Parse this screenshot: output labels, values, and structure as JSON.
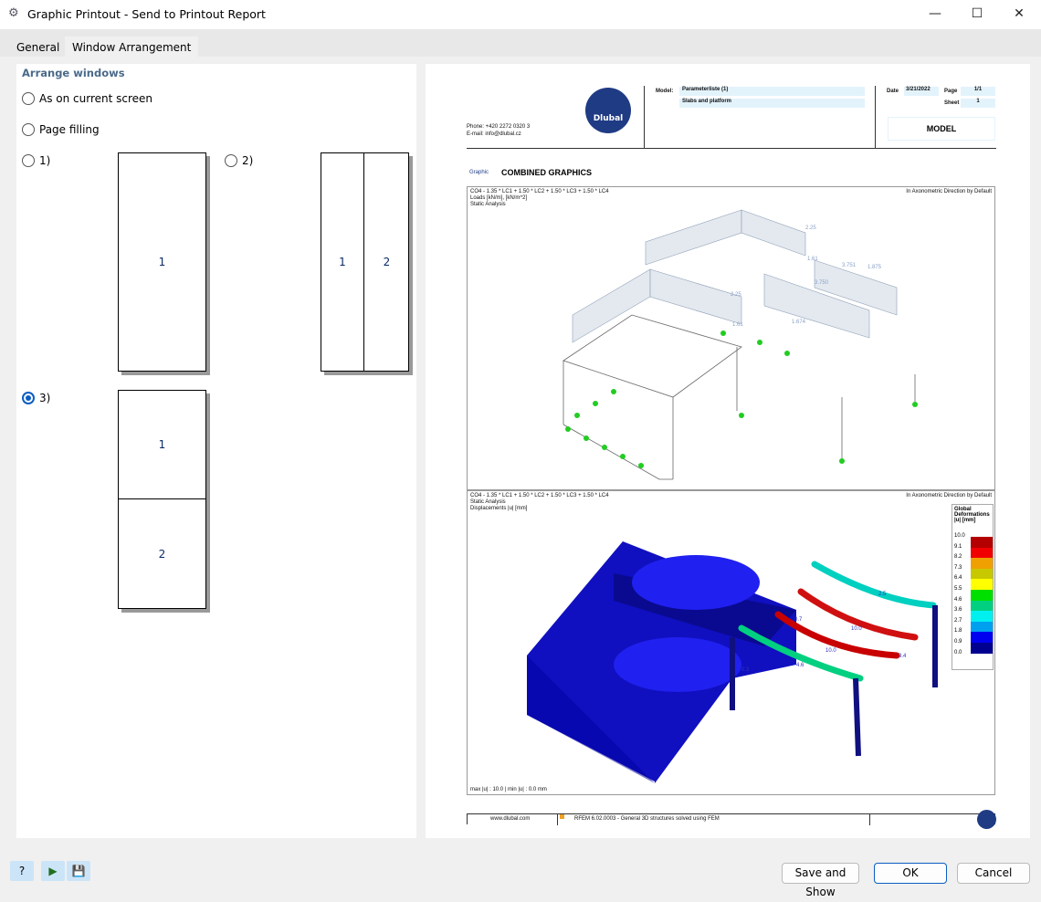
{
  "window": {
    "title": "Graphic Printout - Send to Printout Report",
    "minimize": "—",
    "maximize": "☐",
    "close": "✕",
    "app_icon": "printout-icon"
  },
  "tabs": [
    {
      "label": "General",
      "active": false
    },
    {
      "label": "Window Arrangement",
      "active": true
    }
  ],
  "arrange": {
    "heading": "Arrange windows",
    "options": [
      {
        "label": "As on current screen",
        "selected": false
      },
      {
        "label": "Page filling",
        "selected": false
      },
      {
        "label": "1)",
        "selected": false,
        "cells": [
          "1"
        ]
      },
      {
        "label": "2)",
        "selected": false,
        "cells": [
          "1",
          "2"
        ]
      },
      {
        "label": "3)",
        "selected": true,
        "cells": [
          "1",
          "2"
        ]
      }
    ]
  },
  "preview": {
    "header": {
      "phone": "Phone: +420 2272 0320 3",
      "email": "E-mail: info@dlubal.cz",
      "logo_text": "Dlubal",
      "model_label": "Model:",
      "model_name": "Parameterliste (1)",
      "model_desc": "Slabs and platform",
      "date_label": "Date",
      "date": "3/21/2022",
      "page_label": "Page",
      "page": "1/1",
      "sheet_label": "Sheet",
      "sheet": "1",
      "section": "MODEL"
    },
    "graphic_label": "Graphic",
    "graphic_title": "COMBINED GRAPHICS",
    "graphic1": {
      "combo": "CO4 - 1.35 * LC1 + 1.50 * LC2 + 1.50 * LC3 + 1.50 * LC4",
      "line2": "Loads [kN/m], [kN/m^2]",
      "line3": "Static Analysis",
      "direction": "In Axonometric Direction by Default",
      "load_values": [
        "2.25",
        "1.61",
        "3.751",
        "1.875",
        "3.750",
        "2.25",
        "1.61",
        "1.674"
      ]
    },
    "graphic2": {
      "combo": "CO4 - 1.35 * LC1 + 1.50 * LC2 + 1.50 * LC3 + 1.50 * LC4",
      "line2": "Static Analysis",
      "line3": "Displacements |u| [mm]",
      "direction": "In Axonometric Direction by Default",
      "footer": "max |u| : 10.0 | min |u| : 0.0 mm",
      "legend": {
        "title1": "Global",
        "title2": "Deformations",
        "title3": "|u| [mm]",
        "values": [
          "10.0",
          "9.1",
          "8.2",
          "7.3",
          "6.4",
          "5.5",
          "4.6",
          "3.6",
          "2.7",
          "1.8",
          "0.9",
          "0.0"
        ],
        "colors": [
          "#b40000",
          "#f00000",
          "#f0a000",
          "#c8c800",
          "#ffff00",
          "#00e000",
          "#00d080",
          "#00f0f0",
          "#00a0f0",
          "#0000f0",
          "#000090"
        ]
      },
      "labels": [
        "2.5",
        "10.0",
        "10.0",
        "3.4",
        "4.6",
        "0.7",
        "0.3"
      ]
    },
    "footer": {
      "website": "www.dlubal.com",
      "software": "RFEM 6.02.0003 - General 3D structures solved using FEM"
    }
  },
  "bottom": {
    "icons": [
      "help-icon",
      "send-graphic-icon",
      "save-settings-icon"
    ],
    "save_show": "Save and Show",
    "ok": "OK",
    "cancel": "Cancel"
  }
}
